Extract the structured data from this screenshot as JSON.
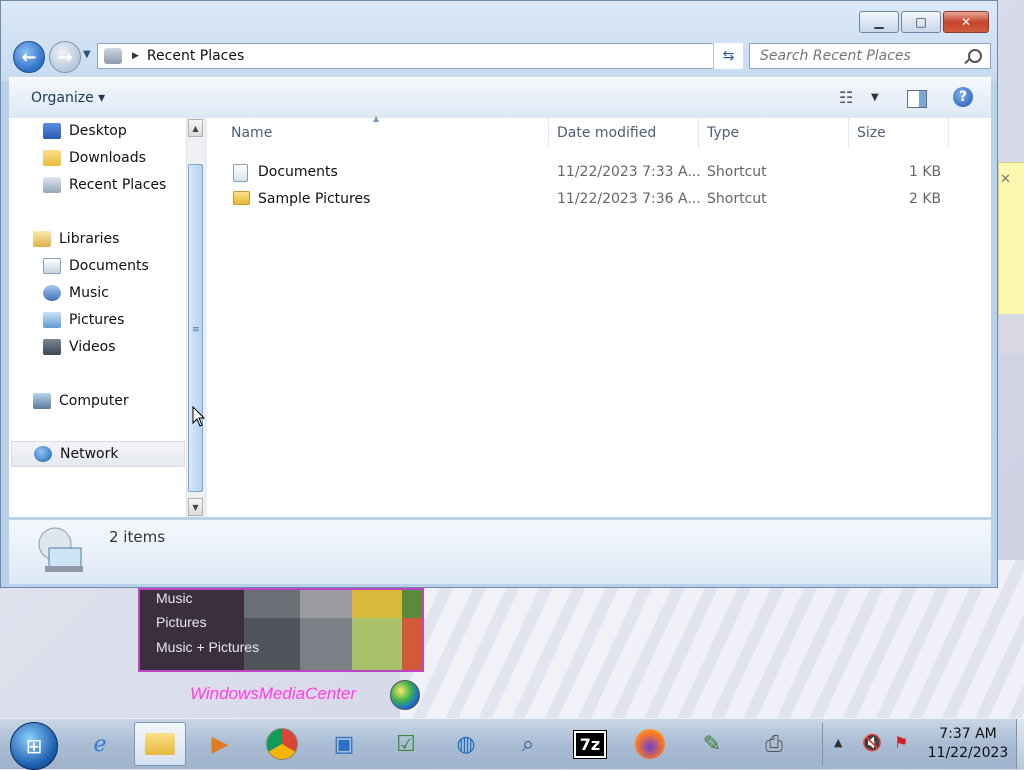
{
  "window": {
    "caption_buttons": {
      "minimize": "▁",
      "maximize": "□",
      "close": "✕"
    },
    "address": {
      "path": "Recent Places"
    },
    "search": {
      "placeholder": "Search Recent Places"
    },
    "toolbar": {
      "organize": "Organize ▾",
      "views_icon": "list-view-icon",
      "help": "?"
    }
  },
  "nav_pane": {
    "items": [
      {
        "label": "Desktop",
        "icon": "desktop-icon",
        "indent": 1
      },
      {
        "label": "Downloads",
        "icon": "downloads-icon",
        "indent": 1
      },
      {
        "label": "Recent Places",
        "icon": "recent-places-icon",
        "indent": 1
      },
      {
        "label": "Libraries",
        "icon": "libraries-icon",
        "indent": 0
      },
      {
        "label": "Documents",
        "icon": "documents-icon",
        "indent": 1
      },
      {
        "label": "Music",
        "icon": "music-icon",
        "indent": 1
      },
      {
        "label": "Pictures",
        "icon": "pictures-icon",
        "indent": 1
      },
      {
        "label": "Videos",
        "icon": "videos-icon",
        "indent": 1
      },
      {
        "label": "Computer",
        "icon": "computer-icon",
        "indent": 0
      },
      {
        "label": "Network",
        "icon": "network-icon",
        "indent": 0
      }
    ]
  },
  "columns": {
    "name": "Name",
    "date": "Date modified",
    "type": "Type",
    "size": "Size"
  },
  "files": [
    {
      "name": "Documents",
      "date": "11/22/2023 7:33 A...",
      "type": "Shortcut",
      "size": "1 KB"
    },
    {
      "name": "Sample Pictures",
      "date": "11/22/2023 7:36 A...",
      "type": "Shortcut",
      "size": "2 KB"
    }
  ],
  "details": {
    "count": "2 items"
  },
  "desktop": {
    "wmc_items": [
      "Music",
      "Pictures",
      "Music + Pictures"
    ],
    "wmc_logo": "WindowsMediaCenter"
  },
  "taskbar": {
    "apps": [
      "internet-explorer-icon",
      "windows-explorer-icon",
      "media-player-icon",
      "chrome-icon",
      "remote-desktop-icon",
      "task-scheduler-icon",
      "network-globe-icon",
      "magnifier-icon",
      "7zip-icon",
      "firefox-icon",
      "notepad-icon",
      "fax-icon"
    ],
    "seven_zip_label": "7z",
    "time": "7:37 AM",
    "date": "11/22/2023"
  }
}
